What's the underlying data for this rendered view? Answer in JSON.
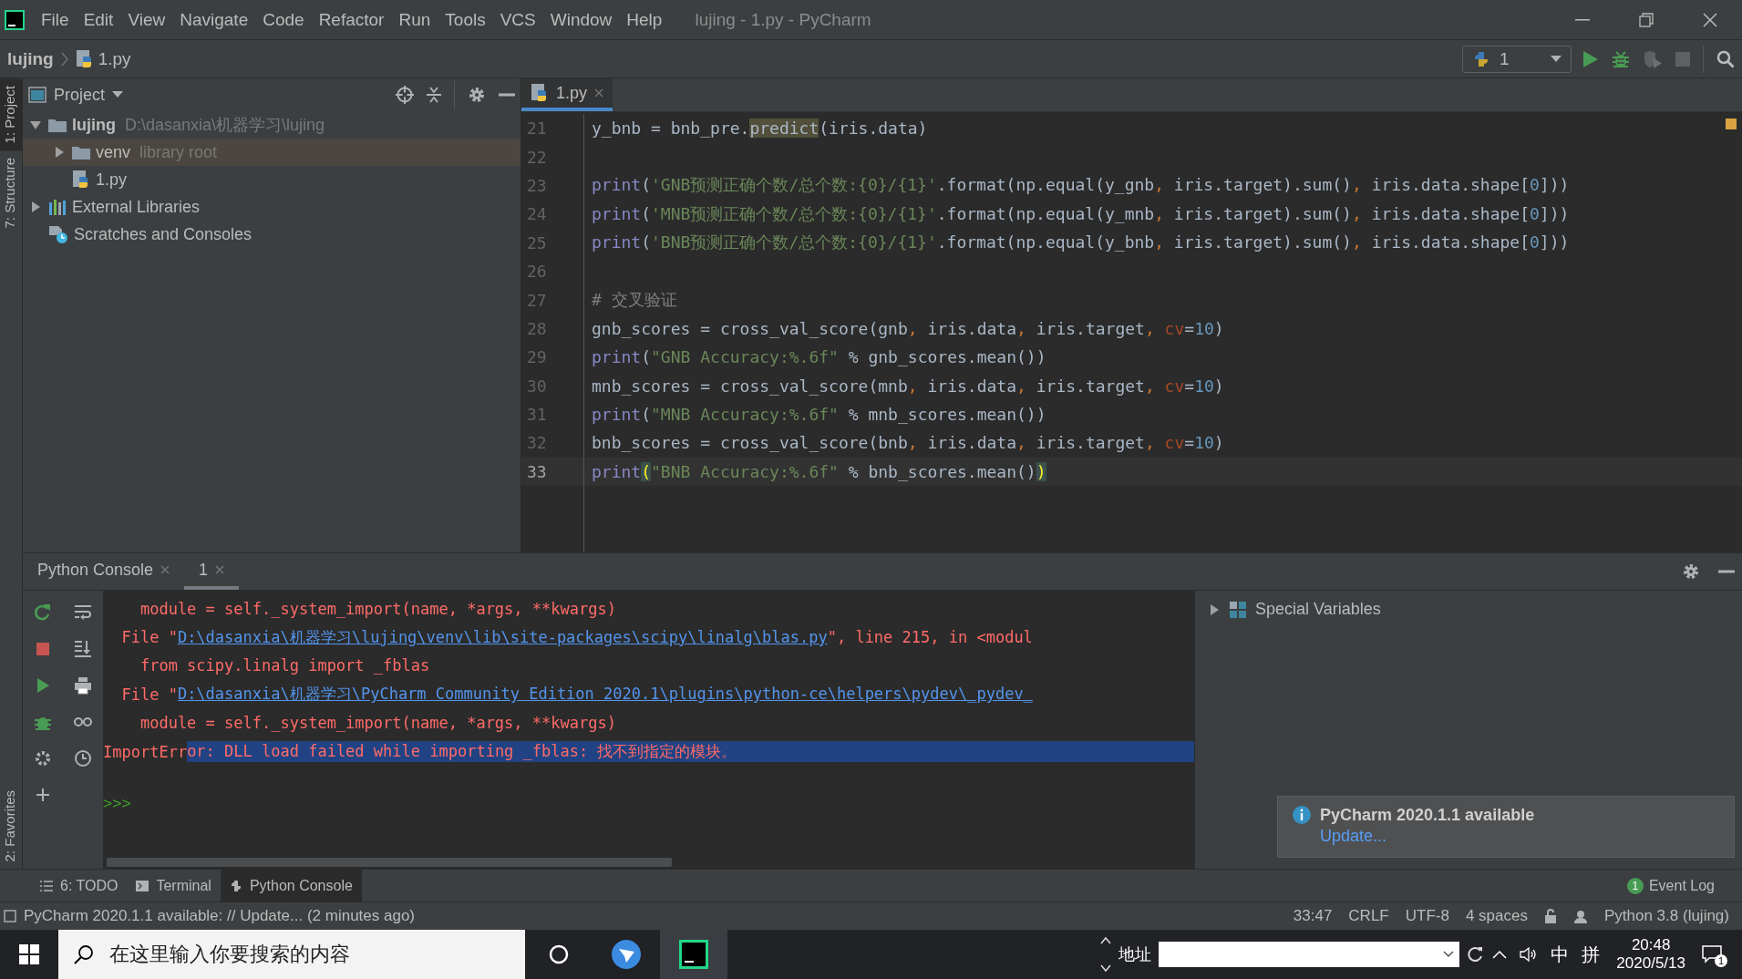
{
  "title_bar": {
    "menu": [
      "File",
      "Edit",
      "View",
      "Navigate",
      "Code",
      "Refactor",
      "Run",
      "Tools",
      "VCS",
      "Window",
      "Help"
    ],
    "title": "lujing - 1.py - PyCharm"
  },
  "nav_bar": {
    "breadcrumbs": [
      "lujing",
      "1.py"
    ],
    "run_config": "1"
  },
  "left_stripe": {
    "top": [
      {
        "label": "1: Project",
        "selected": true
      },
      {
        "label": "7: Structure",
        "selected": false
      }
    ],
    "bottom": [
      {
        "label": "2: Favorites",
        "selected": false
      }
    ]
  },
  "project_panel": {
    "title": "Project",
    "tree": [
      {
        "label": "lujing",
        "detail": "D:\\dasanxia\\机器学习\\lujing",
        "kind": "folder",
        "expanded": true,
        "selected": false,
        "children": [
          {
            "label": "venv",
            "detail": "library root",
            "kind": "folder",
            "expanded": false,
            "selected": true
          },
          {
            "label": "1.py",
            "kind": "python",
            "selected": false
          }
        ]
      },
      {
        "label": "External Libraries",
        "kind": "libraries",
        "expanded": false,
        "selected": false
      },
      {
        "label": "Scratches and Consoles",
        "kind": "scratches",
        "selected": false
      }
    ]
  },
  "editor": {
    "tabs": [
      {
        "label": "1.py",
        "selected": true
      }
    ],
    "lines": [
      {
        "number": "21",
        "current": false,
        "tokens": [
          {
            "kind": "plain",
            "text": "y_bnb = bnb_pre."
          },
          {
            "kind": "usage",
            "text": "predict"
          },
          {
            "kind": "plain",
            "text": "(iris.data)"
          }
        ]
      },
      {
        "number": "22",
        "current": false
      },
      {
        "number": "23",
        "current": false,
        "tokens": [
          {
            "kind": "keyword",
            "text": "print"
          },
          {
            "kind": "plain",
            "text": "("
          },
          {
            "kind": "string",
            "text": "'GNB预测正确个数/总个数:{0}/{1}'"
          },
          {
            "kind": "plain",
            "text": ".format(np.equal(y_gnb"
          },
          {
            "kind": "comma",
            "text": ", "
          },
          {
            "kind": "plain",
            "text": "iris.target).sum()"
          },
          {
            "kind": "comma",
            "text": ", "
          },
          {
            "kind": "plain",
            "text": "iris.data.shape["
          },
          {
            "kind": "number",
            "text": "0"
          },
          {
            "kind": "plain",
            "text": "]))"
          }
        ]
      },
      {
        "number": "24",
        "current": false,
        "tokens": [
          {
            "kind": "keyword",
            "text": "print"
          },
          {
            "kind": "plain",
            "text": "("
          },
          {
            "kind": "string",
            "text": "'MNB预测正确个数/总个数:{0}/{1}'"
          },
          {
            "kind": "plain",
            "text": ".format(np.equal(y_mnb"
          },
          {
            "kind": "comma",
            "text": ", "
          },
          {
            "kind": "plain",
            "text": "iris.target).sum()"
          },
          {
            "kind": "comma",
            "text": ", "
          },
          {
            "kind": "plain",
            "text": "iris.data.shape["
          },
          {
            "kind": "number",
            "text": "0"
          },
          {
            "kind": "plain",
            "text": "]))"
          }
        ]
      },
      {
        "number": "25",
        "current": false,
        "tokens": [
          {
            "kind": "keyword",
            "text": "print"
          },
          {
            "kind": "plain",
            "text": "("
          },
          {
            "kind": "string",
            "text": "'BNB预测正确个数/总个数:{0}/{1}'"
          },
          {
            "kind": "plain",
            "text": ".format(np.equal(y_bnb"
          },
          {
            "kind": "comma",
            "text": ", "
          },
          {
            "kind": "plain",
            "text": "iris.target).sum()"
          },
          {
            "kind": "comma",
            "text": ", "
          },
          {
            "kind": "plain",
            "text": "iris.data.shape["
          },
          {
            "kind": "number",
            "text": "0"
          },
          {
            "kind": "plain",
            "text": "]))"
          }
        ]
      },
      {
        "number": "26",
        "current": false
      },
      {
        "number": "27",
        "current": false,
        "tokens": [
          {
            "kind": "comment",
            "text": "# 交叉验证"
          }
        ]
      },
      {
        "number": "28",
        "current": false,
        "tokens": [
          {
            "kind": "plain",
            "text": "gnb_scores = cross_val_score(gnb"
          },
          {
            "kind": "comma",
            "text": ", "
          },
          {
            "kind": "plain",
            "text": "iris.data"
          },
          {
            "kind": "comma",
            "text": ", "
          },
          {
            "kind": "plain",
            "text": "iris.target"
          },
          {
            "kind": "comma",
            "text": ", "
          },
          {
            "kind": "param",
            "text": "cv"
          },
          {
            "kind": "plain",
            "text": "="
          },
          {
            "kind": "number",
            "text": "10"
          },
          {
            "kind": "plain",
            "text": ")"
          }
        ]
      },
      {
        "number": "29",
        "current": false,
        "tokens": [
          {
            "kind": "keyword",
            "text": "print"
          },
          {
            "kind": "plain",
            "text": "("
          },
          {
            "kind": "string",
            "text": "\"GNB Accuracy:%.6f\""
          },
          {
            "kind": "plain",
            "text": " % gnb_scores.mean())"
          }
        ]
      },
      {
        "number": "30",
        "current": false,
        "tokens": [
          {
            "kind": "plain",
            "text": "mnb_scores = cross_val_score(mnb"
          },
          {
            "kind": "comma",
            "text": ", "
          },
          {
            "kind": "plain",
            "text": "iris.data"
          },
          {
            "kind": "comma",
            "text": ", "
          },
          {
            "kind": "plain",
            "text": "iris.target"
          },
          {
            "kind": "comma",
            "text": ", "
          },
          {
            "kind": "param",
            "text": "cv"
          },
          {
            "kind": "plain",
            "text": "="
          },
          {
            "kind": "number",
            "text": "10"
          },
          {
            "kind": "plain",
            "text": ")"
          }
        ]
      },
      {
        "number": "31",
        "current": false,
        "tokens": [
          {
            "kind": "keyword",
            "text": "print"
          },
          {
            "kind": "plain",
            "text": "("
          },
          {
            "kind": "string",
            "text": "\"MNB Accuracy:%.6f\""
          },
          {
            "kind": "plain",
            "text": " % mnb_scores.mean())"
          }
        ]
      },
      {
        "number": "32",
        "current": false,
        "tokens": [
          {
            "kind": "plain",
            "text": "bnb_scores = cross_val_score(bnb"
          },
          {
            "kind": "comma",
            "text": ", "
          },
          {
            "kind": "plain",
            "text": "iris.data"
          },
          {
            "kind": "comma",
            "text": ", "
          },
          {
            "kind": "plain",
            "text": "iris.target"
          },
          {
            "kind": "comma",
            "text": ", "
          },
          {
            "kind": "param",
            "text": "cv"
          },
          {
            "kind": "plain",
            "text": "="
          },
          {
            "kind": "number",
            "text": "10"
          },
          {
            "kind": "plain",
            "text": ")"
          }
        ]
      },
      {
        "number": "33",
        "current": true,
        "tokens": [
          {
            "kind": "keyword",
            "text": "print"
          },
          {
            "kind": "brace",
            "text": "("
          },
          {
            "kind": "string",
            "text": "\"BNB Accuracy:%.6f\""
          },
          {
            "kind": "plain",
            "text": " % bnb_scores.mean()"
          },
          {
            "kind": "brace",
            "text": ")"
          }
        ]
      }
    ]
  },
  "console": {
    "tabs": [
      {
        "label": "Python Console",
        "selected": false
      },
      {
        "label": "1",
        "selected": true
      }
    ],
    "lines": [
      [
        {
          "kind": "error",
          "text": "    module = self._system_import(name, *args, **kwargs)"
        }
      ],
      [
        {
          "kind": "error",
          "text": "  File \""
        },
        {
          "kind": "link",
          "text": "D:\\dasanxia\\机器学习\\lujing\\venv\\lib\\site-packages\\scipy\\linalg\\blas.py"
        },
        {
          "kind": "error",
          "text": "\", line 215, in <modul"
        }
      ],
      [
        {
          "kind": "error",
          "text": "    from scipy.linalg import _fblas"
        }
      ],
      [
        {
          "kind": "error",
          "text": "  File \""
        },
        {
          "kind": "link",
          "text": "D:\\dasanxia\\机器学习\\PyCharm Community Edition 2020.1\\plugins\\python-ce\\helpers\\pydev\\_pydev_"
        }
      ],
      [
        {
          "kind": "error",
          "text": "    module = self._system_import(name, *args, **kwargs)"
        }
      ],
      [
        {
          "kind": "error",
          "text": "ImportErr"
        },
        {
          "kind": "selected",
          "text": "or: DLL load failed while importing _fblas: 找不到指定的模块。"
        }
      ]
    ],
    "prompt": ">>>",
    "variables": [
      {
        "label": "Special Variables",
        "expanded": false
      }
    ]
  },
  "notification": {
    "title": "PyCharm 2020.1.1 available",
    "link": "Update..."
  },
  "bottom_tabs": [
    {
      "label": "6: TODO",
      "selected": false
    },
    {
      "label": "Terminal",
      "selected": false
    },
    {
      "label": "Python Console",
      "selected": true
    }
  ],
  "event_log": {
    "label": "Event Log",
    "count": "1"
  },
  "status_bar": {
    "message": "PyCharm 2020.1.1 available: // Update... (2 minutes ago)",
    "items": [
      "33:47",
      "CRLF",
      "UTF-8",
      "4 spaces",
      "Python 3.8 (lujing)"
    ]
  },
  "taskbar": {
    "search_placeholder": "在这里输入你要搜索的内容",
    "address_label": "地址",
    "ime": [
      "中",
      "拼"
    ],
    "time": "20:48",
    "date": "2020/5/13",
    "notification_count": "1"
  }
}
